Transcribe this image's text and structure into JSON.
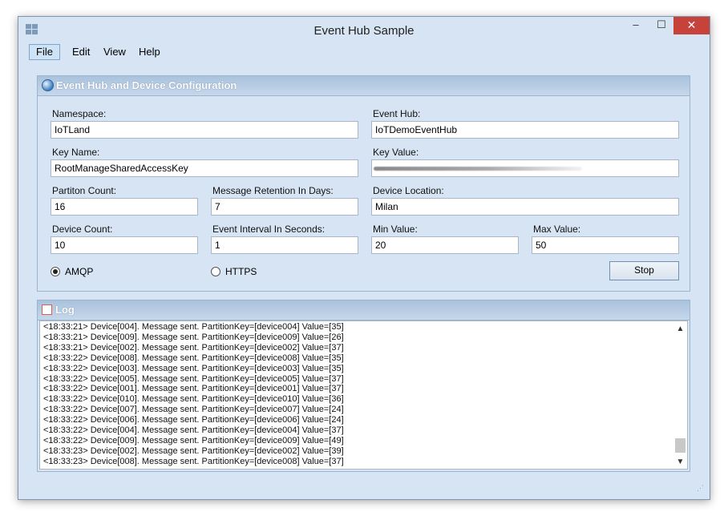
{
  "window": {
    "title": "Event Hub Sample"
  },
  "titlebar": {
    "minimize": "–",
    "maximize": "☐",
    "close": "✕"
  },
  "menu": [
    "File",
    "Edit",
    "View",
    "Help"
  ],
  "config": {
    "header": "Event Hub and Device Configuration",
    "namespace": {
      "label": "Namespace:",
      "value": "IoTLand"
    },
    "event_hub": {
      "label": "Event Hub:",
      "value": "IoTDemoEventHub"
    },
    "key_name": {
      "label": "Key Name:",
      "value": "RootManageSharedAccessKey"
    },
    "key_value": {
      "label": "Key Value:"
    },
    "partition_count": {
      "label": "Partiton Count:",
      "value": "16"
    },
    "message_retention": {
      "label": "Message Retention In Days:",
      "value": "7"
    },
    "device_location": {
      "label": "Device Location:",
      "value": "Milan"
    },
    "device_count": {
      "label": "Device Count:",
      "value": "10"
    },
    "event_interval": {
      "label": "Event Interval In Seconds:",
      "value": "1"
    },
    "min_value": {
      "label": "Min Value:",
      "value": "20"
    },
    "max_value": {
      "label": "Max Value:",
      "value": "50"
    },
    "protocol": {
      "amqp": "AMQP",
      "https": "HTTPS",
      "selected": "AMQP"
    },
    "stop_button": "Stop"
  },
  "log": {
    "header": "Log",
    "lines": [
      "<18:33:21> Device[004]. Message sent. PartitionKey=[device004] Value=[35]",
      "<18:33:21> Device[009]. Message sent. PartitionKey=[device009] Value=[26]",
      "<18:33:21> Device[002]. Message sent. PartitionKey=[device002] Value=[37]",
      "<18:33:22> Device[008]. Message sent. PartitionKey=[device008] Value=[35]",
      "<18:33:22> Device[003]. Message sent. PartitionKey=[device003] Value=[35]",
      "<18:33:22> Device[005]. Message sent. PartitionKey=[device005] Value=[37]",
      "<18:33:22> Device[001]. Message sent. PartitionKey=[device001] Value=[37]",
      "<18:33:22> Device[010]. Message sent. PartitionKey=[device010] Value=[36]",
      "<18:33:22> Device[007]. Message sent. PartitionKey=[device007] Value=[24]",
      "<18:33:22> Device[006]. Message sent. PartitionKey=[device006] Value=[24]",
      "<18:33:22> Device[004]. Message sent. PartitionKey=[device004] Value=[37]",
      "<18:33:22> Device[009]. Message sent. PartitionKey=[device009] Value=[49]",
      "<18:33:23> Device[002]. Message sent. PartitionKey=[device002] Value=[39]",
      "<18:33:23> Device[008]. Message sent. PartitionKey=[device008] Value=[37]"
    ]
  }
}
